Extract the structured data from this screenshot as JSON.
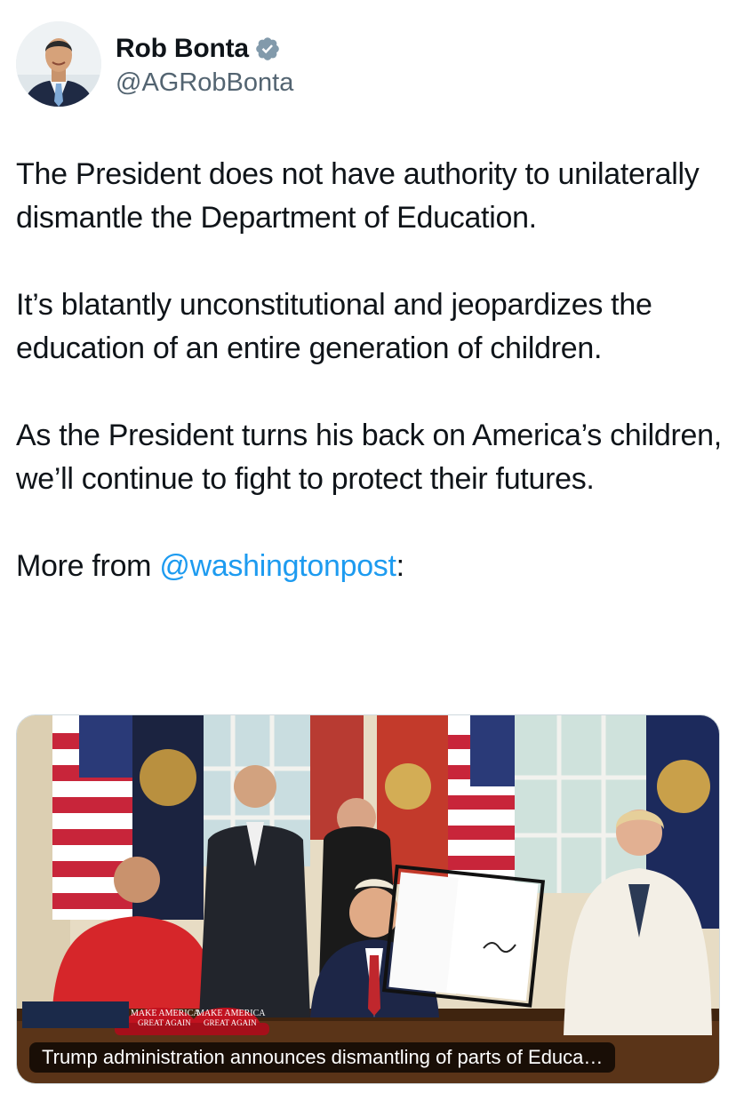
{
  "author": {
    "display_name": "Rob Bonta",
    "handle": "@AGRobBonta",
    "verified_icon": "verified-badge-icon",
    "avatar": "avatar-photo"
  },
  "tweet": {
    "paragraphs": [
      "The President does not have authority to unilaterally dismantle the Department of Education.",
      "It’s blatantly unconstitutional and jeopardizes the education of an entire generation of children.",
      "As the President turns his back on America’s children, we’ll continue to fight to protect their futures."
    ],
    "more_from_prefix": "More from ",
    "more_from_mention": "@washingtonpost",
    "more_from_suffix": ":"
  },
  "link_card": {
    "caption": "Trump administration announces dismantling of parts of Educa…",
    "hat_text_1": "MAKE AMERICA",
    "hat_text_2": "GREAT AGAIN",
    "hat_text_3": "MAKE AMERICA",
    "hat_text_4": "GREAT AGAIN"
  },
  "colors": {
    "link": "#1d9bf0",
    "verified": "#829aab",
    "secondary_text": "#536471"
  }
}
